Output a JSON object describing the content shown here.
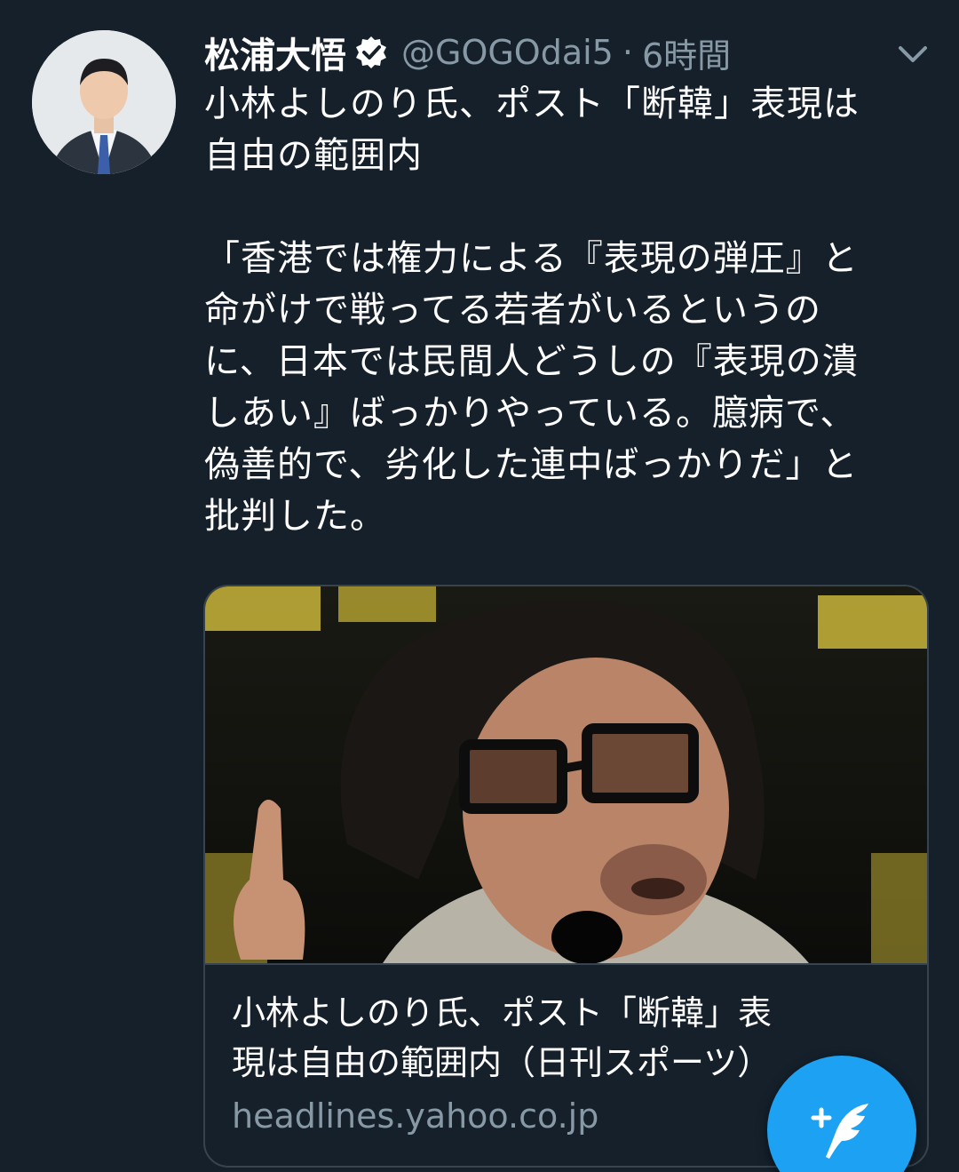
{
  "tweet": {
    "author_name": "松浦大悟",
    "verified": true,
    "handle": "@GOGOdai5",
    "separator": "·",
    "time": "6時間",
    "text_lines": [
      "小林よしのり氏、ポスト「断韓」表現は",
      "自由の範囲内",
      "「香港では権力による『表現の弾圧』と",
      "命がけで戦ってる若者がいるというの",
      "に、日本では民間人どうしの『表現の潰",
      "しあい』ばっかりやっている。臆病で、",
      "偽善的で、劣化した連中ばっかりだ」と",
      "批判した。"
    ]
  },
  "card": {
    "title_line1": "小林よしのり氏、ポスト「断韓」表",
    "title_line2": "現は自由の範囲内（日刊スポーツ）",
    "domain": "headlines.yahoo.co.jp"
  },
  "icons": {
    "verified": "verified-badge-icon",
    "chevron": "chevron-down-icon",
    "compose": "compose-tweet-icon"
  },
  "colors": {
    "background": "#15202b",
    "secondary_text": "#8899a6",
    "accent": "#1da1f2",
    "border": "#38444d"
  }
}
